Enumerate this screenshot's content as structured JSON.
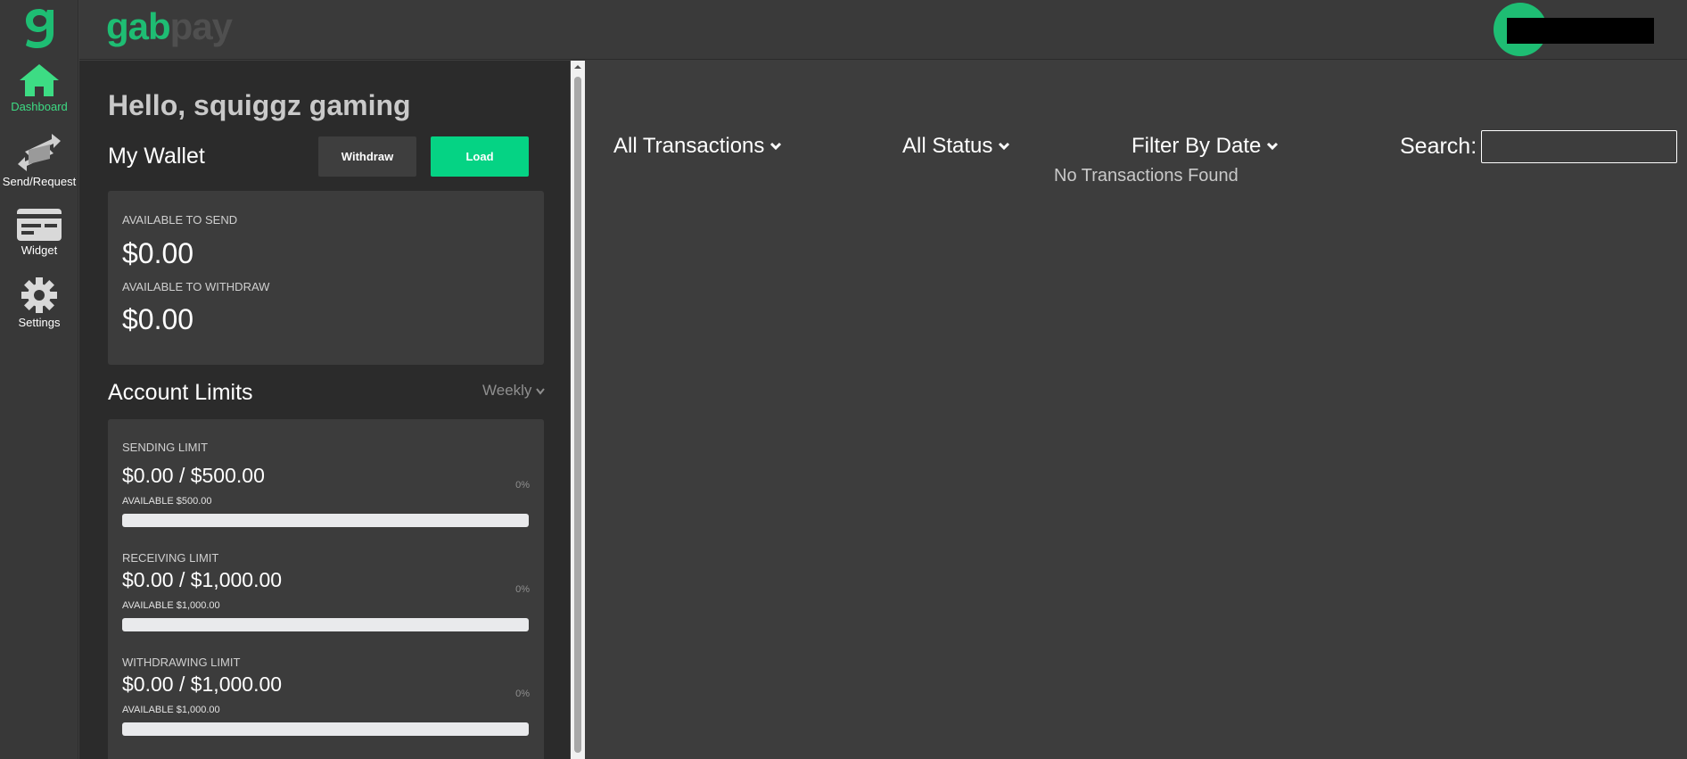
{
  "brand": {
    "part1": "gab",
    "part2": "pay"
  },
  "colors": {
    "accent": "#1ebd73",
    "load_button": "#05d384",
    "background": "#3d3d3d",
    "panel": "#2b2b2b"
  },
  "nav": {
    "items": [
      {
        "label": "Dashboard",
        "icon": "home-icon",
        "active": true
      },
      {
        "label": "Send/Request",
        "icon": "send-request-icon",
        "active": false
      },
      {
        "label": "Widget",
        "icon": "widget-card-icon",
        "active": false
      },
      {
        "label": "Settings",
        "icon": "gear-icon",
        "active": false
      }
    ]
  },
  "greeting": "Hello, squiggz gaming",
  "wallet": {
    "title": "My Wallet",
    "withdraw_label": "Withdraw",
    "load_label": "Load",
    "send_caption": "AVAILABLE TO SEND",
    "send_amount": "$0.00",
    "withdraw_caption": "AVAILABLE TO WITHDRAW",
    "withdraw_amount": "$0.00"
  },
  "limits": {
    "title": "Account Limits",
    "period": "Weekly",
    "items": [
      {
        "caption": "SENDING LIMIT",
        "amount": "$0.00 / $500.00",
        "available": "AVAILABLE $500.00",
        "percent_label": "0%",
        "progress": 0
      },
      {
        "caption": "RECEIVING LIMIT",
        "amount": "$0.00 / $1,000.00",
        "available": "AVAILABLE $1,000.00",
        "percent_label": "0%",
        "progress": 0
      },
      {
        "caption": "WITHDRAWING LIMIT",
        "amount": "$0.00 / $1,000.00",
        "available": "AVAILABLE $1,000.00",
        "percent_label": "0%",
        "progress": 0
      }
    ]
  },
  "transactions": {
    "type_filter": "All Transactions",
    "status_filter": "All Status",
    "date_filter": "Filter By Date",
    "search_label": "Search:",
    "search_value": "",
    "empty_message": "No Transactions Found"
  }
}
